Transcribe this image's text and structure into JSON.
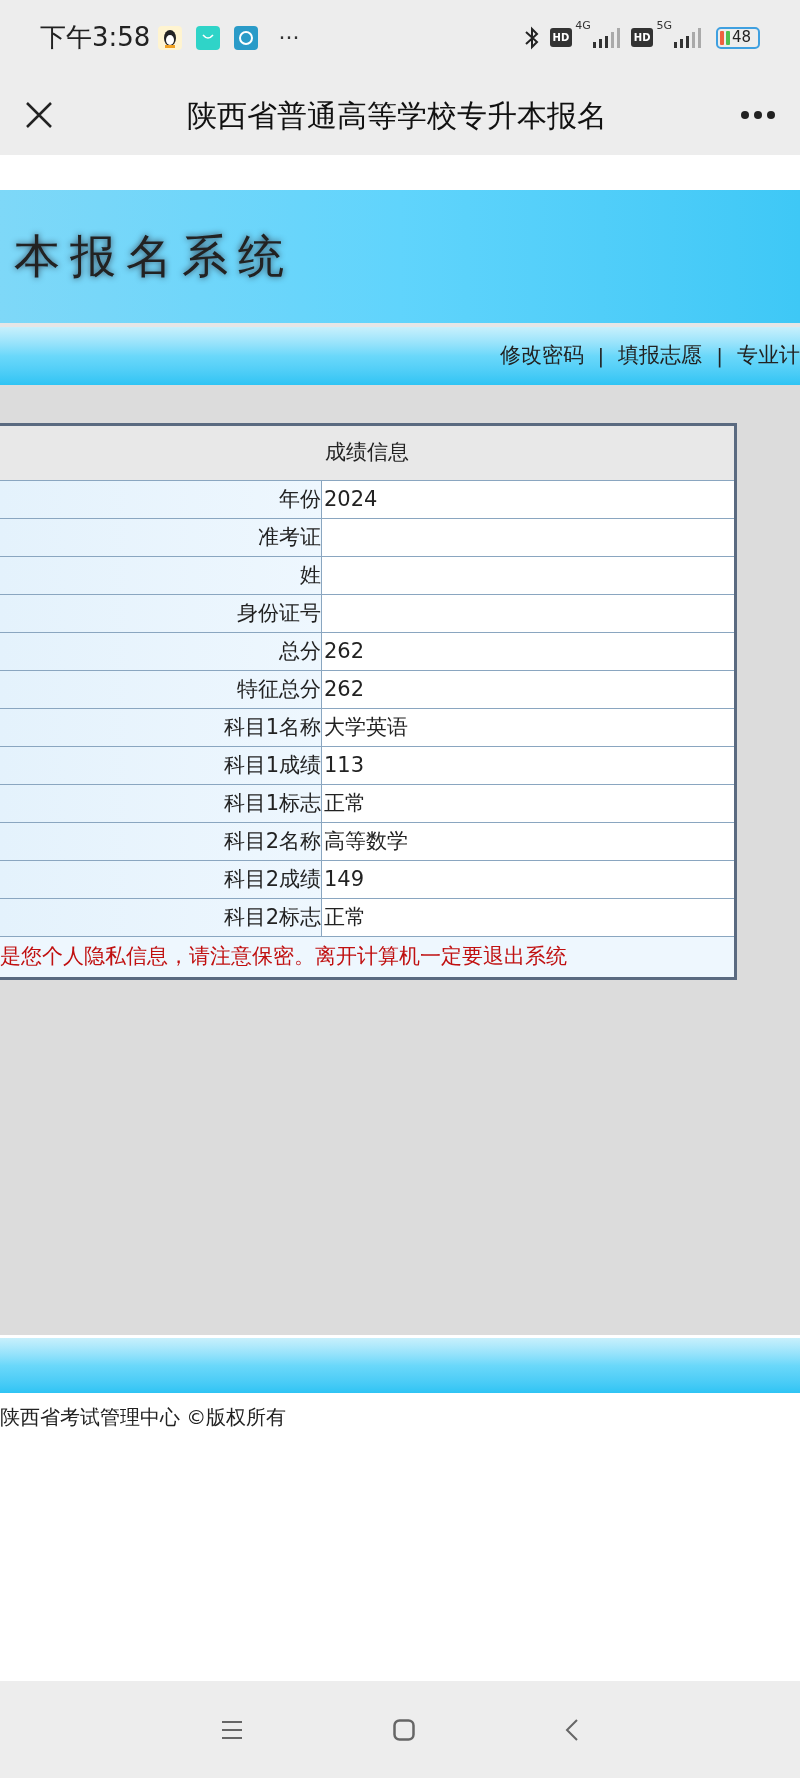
{
  "status_bar": {
    "time": "下午3:58",
    "more": "···",
    "hd_1": "HD",
    "hd_2": "HD",
    "network_1": "4G",
    "network_2": "5G",
    "battery": "48"
  },
  "app_bar": {
    "title": "陕西省普通高等学校专升本报名"
  },
  "banner": {
    "title": "本报名系统"
  },
  "nav": {
    "links": [
      "修改密码",
      "填报志愿",
      "专业计"
    ],
    "separator": "|"
  },
  "table": {
    "title": "成绩信息",
    "rows": [
      {
        "label": "年份",
        "value": "2024"
      },
      {
        "label": "准考证"
      },
      {
        "label": "姓"
      },
      {
        "label": "身份证号"
      },
      {
        "label": "总分",
        "value": "262"
      },
      {
        "label": "特征总分",
        "value": "262"
      },
      {
        "label": "科目1名称",
        "value": "大学英语"
      },
      {
        "label": "科目1成绩",
        "value": "113"
      },
      {
        "label": "科目1标志",
        "value": "正常"
      },
      {
        "label": "科目2名称",
        "value": "高等数学"
      },
      {
        "label": "科目2成绩",
        "value": "149"
      },
      {
        "label": "科目2标志",
        "value": "正常"
      }
    ],
    "notice": "是您个人隐私信息，请注意保密。离开计算机一定要退出系统"
  },
  "footer": {
    "copyright": "陕西省考试管理中心 ©版权所有"
  }
}
